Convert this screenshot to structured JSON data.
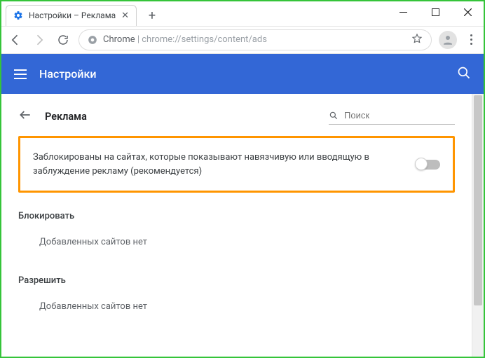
{
  "window": {
    "tab_title": "Настройки – Реклама"
  },
  "addressbar": {
    "prefix": "Chrome",
    "separator": " | ",
    "url": "chrome://settings/content/ads"
  },
  "header": {
    "title": "Настройки"
  },
  "page": {
    "title": "Реклама",
    "search_placeholder": "Поиск",
    "toggle_label": "Заблокированы на сайтах, которые показывают навязчивую или вводящую в заблуждение рекламу (рекомендуется)",
    "block_section": "Блокировать",
    "allow_section": "Разрешить",
    "empty_text": "Добавленных сайтов нет"
  }
}
